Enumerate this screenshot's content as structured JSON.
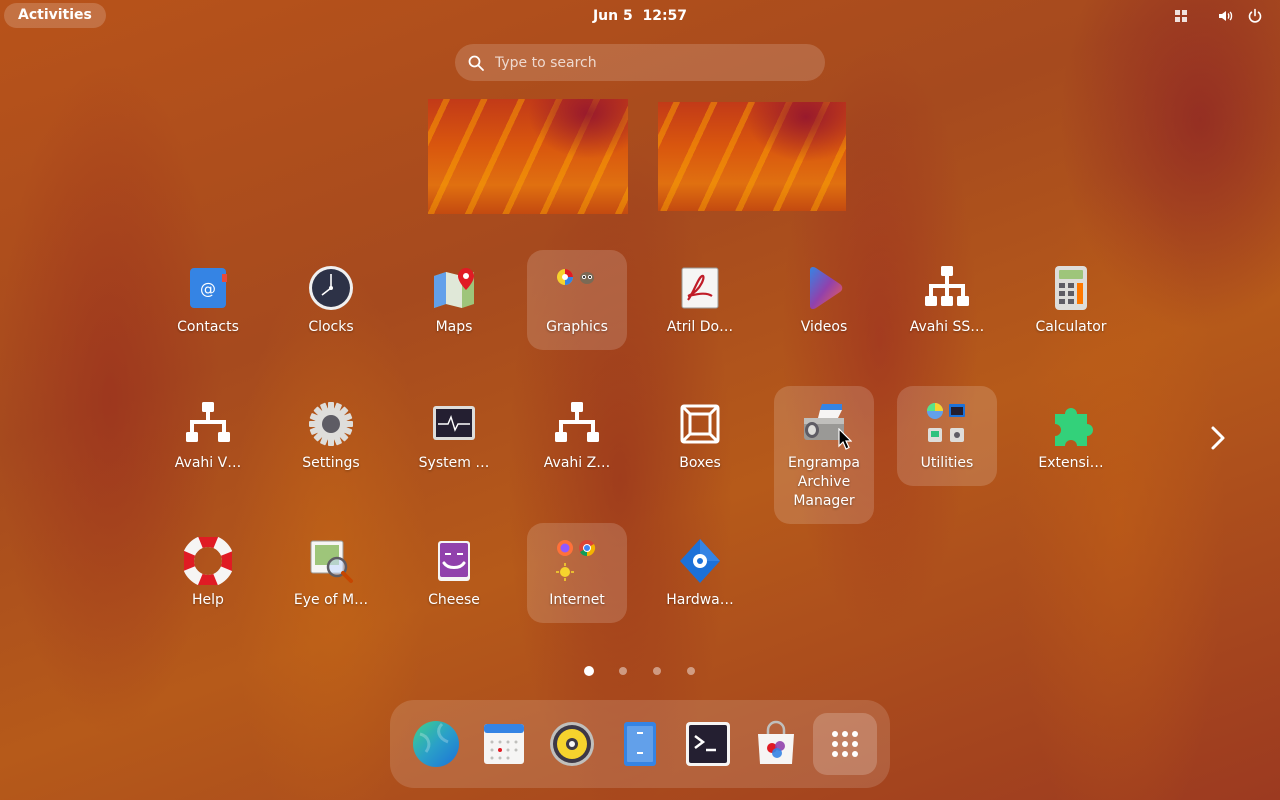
{
  "topbar": {
    "activities_label": "Activities",
    "date": "Jun 5",
    "time": "12:57",
    "tray_icons": [
      "keyboard-layout-icon",
      "volume-icon",
      "power-icon"
    ]
  },
  "search": {
    "placeholder": "Type to search",
    "value": ""
  },
  "workspaces": {
    "count": 2
  },
  "apps": [
    {
      "label": "Contacts",
      "icon": "contacts-icon"
    },
    {
      "label": "Clocks",
      "icon": "clock-icon"
    },
    {
      "label": "Maps",
      "icon": "maps-icon"
    },
    {
      "label": "Graphics",
      "icon": "folder-icon",
      "folder": true
    },
    {
      "label": "Atril Do…",
      "icon": "document-viewer-icon"
    },
    {
      "label": "Videos",
      "icon": "videos-icon"
    },
    {
      "label": "Avahi SS…",
      "icon": "network-icon"
    },
    {
      "label": "Calculator",
      "icon": "calculator-icon"
    },
    {
      "label": "Avahi V…",
      "icon": "network-icon"
    },
    {
      "label": "Settings",
      "icon": "gear-icon"
    },
    {
      "label": "System …",
      "icon": "system-monitor-icon"
    },
    {
      "label": "Avahi Z…",
      "icon": "network-icon"
    },
    {
      "label": "Boxes",
      "icon": "boxes-icon"
    },
    {
      "label": "Engrampa Archive Manager",
      "icon": "archive-manager-icon",
      "hover": true
    },
    {
      "label": "Utilities",
      "icon": "folder-icon",
      "folder": true
    },
    {
      "label": "Extensi…",
      "icon": "puzzle-icon"
    },
    {
      "label": "Help",
      "icon": "lifebuoy-icon"
    },
    {
      "label": "Eye of M…",
      "icon": "image-viewer-icon"
    },
    {
      "label": "Cheese",
      "icon": "webcam-icon"
    },
    {
      "label": "Internet",
      "icon": "folder-icon",
      "folder": true
    },
    {
      "label": "Hardwa…",
      "icon": "hardware-icon"
    }
  ],
  "pagination": {
    "pages": 4,
    "current": 1
  },
  "dash": {
    "items": [
      "web-browser-icon",
      "calendar-icon",
      "music-player-icon",
      "file-manager-icon",
      "terminal-icon",
      "software-store-icon"
    ],
    "show_apps": "show-apps-icon"
  },
  "colors": {
    "background": "#b05019",
    "panel_overlay": "rgba(255,255,255,0.16)",
    "accent_blue": "#3584e4"
  }
}
